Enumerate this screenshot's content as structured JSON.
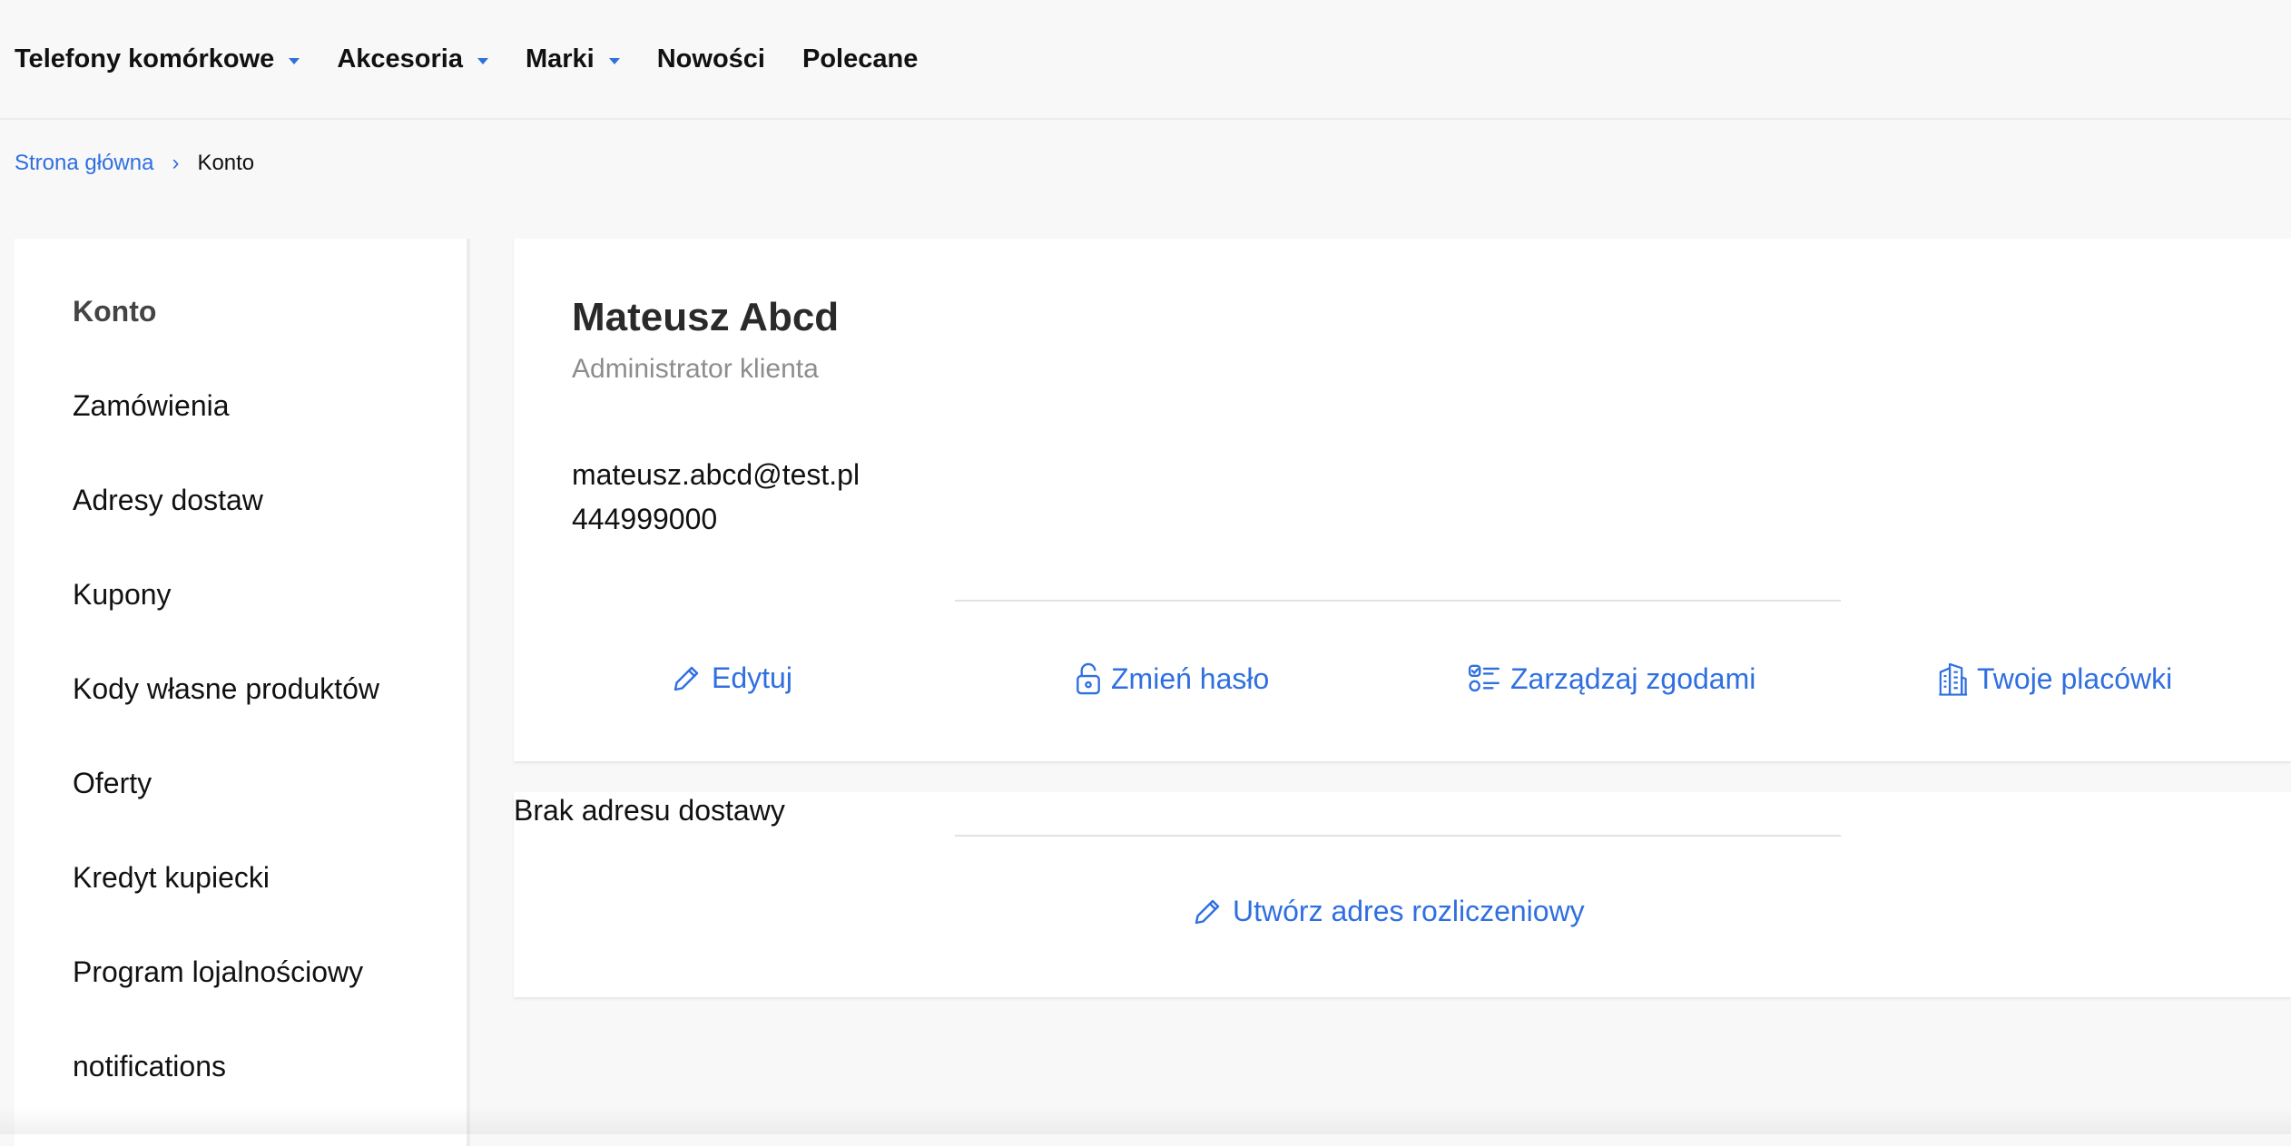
{
  "topnav": {
    "items": [
      {
        "label": "Telefony komórkowe",
        "dropdown": true
      },
      {
        "label": "Akcesoria",
        "dropdown": true
      },
      {
        "label": "Marki",
        "dropdown": true
      },
      {
        "label": "Nowości",
        "dropdown": false
      },
      {
        "label": "Polecane",
        "dropdown": false
      }
    ]
  },
  "breadcrumb": {
    "home": "Strona główna",
    "separator": "›",
    "current": "Konto"
  },
  "sidebar": {
    "items": [
      {
        "label": "Konto",
        "active": true
      },
      {
        "label": "Zamówienia"
      },
      {
        "label": "Adresy dostaw"
      },
      {
        "label": "Kupony"
      },
      {
        "label": "Kody własne produktów"
      },
      {
        "label": "Oferty"
      },
      {
        "label": "Kredyt kupiecki"
      },
      {
        "label": "Program lojalnościowy"
      },
      {
        "label": "notifications"
      }
    ]
  },
  "profile": {
    "name": "Mateusz Abcd",
    "role": "Administrator klienta",
    "email": "mateusz.abcd@test.pl",
    "phone": "444999000",
    "actions": {
      "edit": {
        "label": "Edytuj",
        "icon": "pencil-icon"
      },
      "password": {
        "label": "Zmień hasło",
        "icon": "lock-icon"
      },
      "consents": {
        "label": "Zarządzaj zgodami",
        "icon": "checklist-icon"
      },
      "branches": {
        "label": "Twoje placówki",
        "icon": "building-icon"
      }
    }
  },
  "address": {
    "empty_text": "Brak adresu dostawy",
    "create_label": "Utwórz adres rozliczeniowy",
    "create_icon": "pencil-icon"
  },
  "colors": {
    "accent": "#2f6fe0",
    "background": "#f8f8f8",
    "card": "#ffffff",
    "muted": "#8d8d8d"
  }
}
